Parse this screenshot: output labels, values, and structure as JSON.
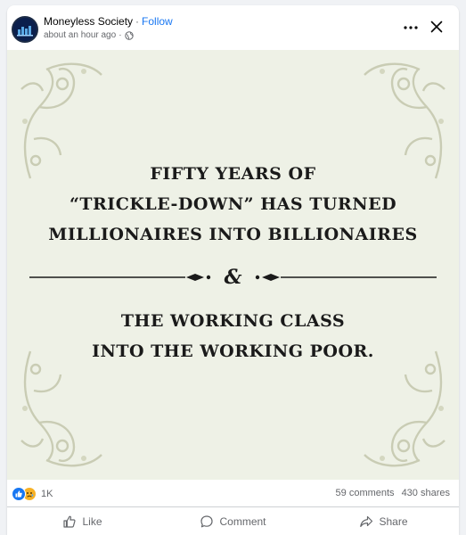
{
  "post": {
    "page_name": "Moneyless Society",
    "separator": "·",
    "follow_label": "Follow",
    "timestamp": "about an hour ago",
    "meta_separator": "·",
    "audience_icon": "globe-icon"
  },
  "image": {
    "line1": "FIFTY YEARS OF",
    "line2": "“TRICKLE-DOWN” HAS TURNED",
    "line3": "MILLIONAIRES INTO BILLIONAIRES",
    "ampersand": "&",
    "line4": "THE WORKING CLASS",
    "line5": "INTO THE WORKING POOR."
  },
  "stats": {
    "reactions_count": "1K",
    "comments": "59 comments",
    "shares": "430 shares",
    "reaction_icons": [
      "like-icon",
      "sad-icon"
    ],
    "like_color": "#1877f2",
    "sad_color": "#f7b125"
  },
  "actions": {
    "like": "Like",
    "comment": "Comment",
    "share": "Share"
  }
}
